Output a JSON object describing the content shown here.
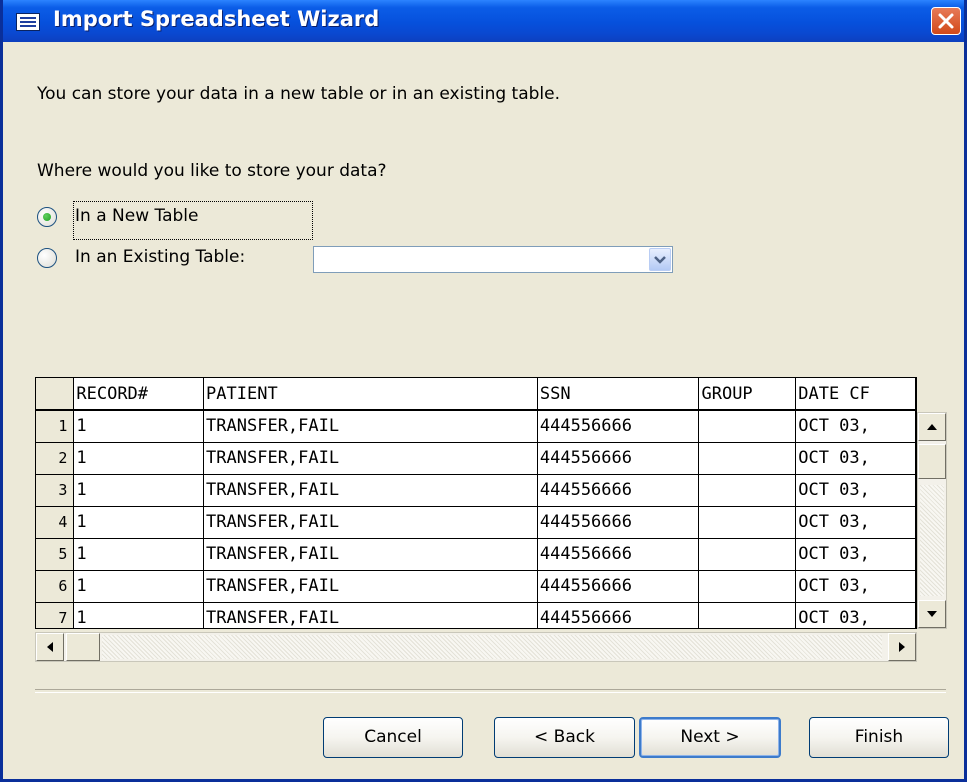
{
  "window": {
    "title": "Import Spreadsheet Wizard"
  },
  "intro": "You can store your data in a new table or in an existing table.",
  "question": "Where would you like to store your data?",
  "options": [
    {
      "label": "In a New Table",
      "selected": true
    },
    {
      "label": "In an Existing Table:",
      "selected": false
    }
  ],
  "existing_table_combo": {
    "value": ""
  },
  "grid": {
    "columns": [
      "RECORD#",
      "PATIENT",
      "SSN",
      "GROUP",
      "DATE CF"
    ],
    "rows": [
      {
        "num": "1",
        "cells": [
          "1",
          "TRANSFER,FAIL",
          "444556666",
          "",
          "OCT 03,"
        ]
      },
      {
        "num": "2",
        "cells": [
          "1",
          "TRANSFER,FAIL",
          "444556666",
          "",
          "OCT 03,"
        ]
      },
      {
        "num": "3",
        "cells": [
          "1",
          "TRANSFER,FAIL",
          "444556666",
          "",
          "OCT 03,"
        ]
      },
      {
        "num": "4",
        "cells": [
          "1",
          "TRANSFER,FAIL",
          "444556666",
          "",
          "OCT 03,"
        ]
      },
      {
        "num": "5",
        "cells": [
          "1",
          "TRANSFER,FAIL",
          "444556666",
          "",
          "OCT 03,"
        ]
      },
      {
        "num": "6",
        "cells": [
          "1",
          "TRANSFER,FAIL",
          "444556666",
          "",
          "OCT 03,"
        ]
      },
      {
        "num": "7",
        "cells": [
          "1",
          "TRANSFER,FAIL",
          "444556666",
          "",
          "OCT 03,"
        ]
      }
    ]
  },
  "buttons": {
    "cancel": "Cancel",
    "back": "< Back",
    "next": "Next >",
    "finish": "Finish"
  }
}
